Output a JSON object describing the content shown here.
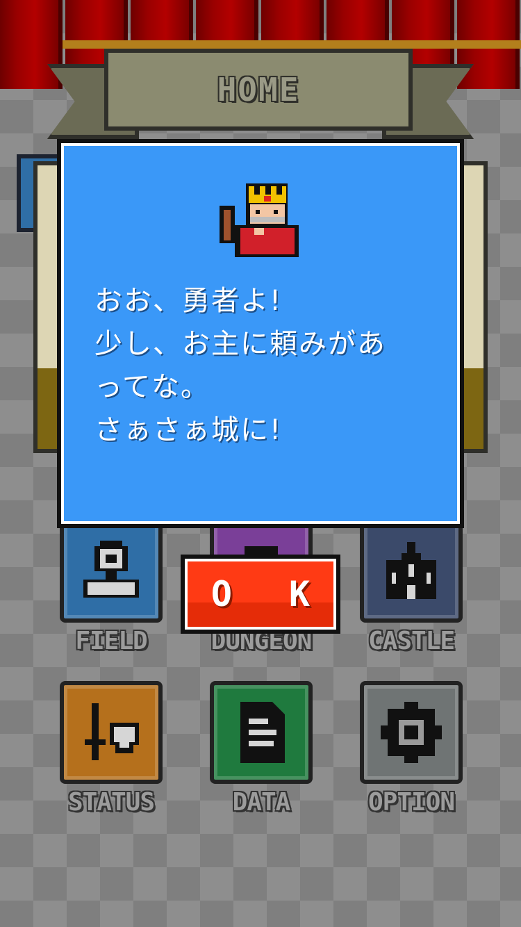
{
  "header": {
    "title": "HOME"
  },
  "dialog": {
    "lines": [
      "おお、勇者よ!",
      "少し、お主に頼みがあ",
      "ってな。",
      "さぁさぁ城に!"
    ],
    "ok_label": "O K"
  },
  "menu": {
    "field": "FIELD",
    "dungeon": "DUNGEON",
    "castle": "CASTLE",
    "status": "STATUS",
    "data": "DATA",
    "option": "OPTION"
  },
  "colors": {
    "dialog_bg": "#3a98f8",
    "ok_button": "#ff3a14",
    "field_tile": "#2f6ea6",
    "dungeon_tile": "#7a3f98",
    "castle_tile": "#3b4a6a",
    "status_tile": "#b5701c",
    "data_tile": "#1f7a3e",
    "option_tile": "#6f7474"
  }
}
